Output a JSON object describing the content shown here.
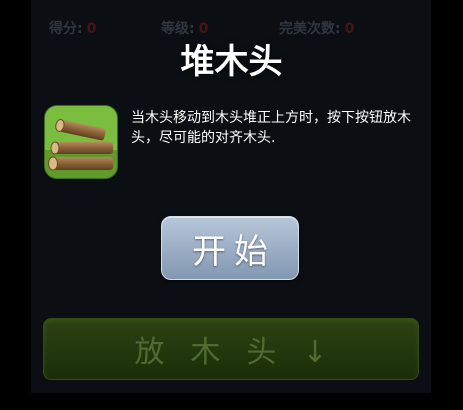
{
  "hud": {
    "score_label": "得分:",
    "score_value": "0",
    "level_label": "等级:",
    "level_value": "0",
    "perfect_label": "完美次数:",
    "perfect_value": "0"
  },
  "overlay": {
    "title": "堆木头",
    "icon": "wood-logs-icon",
    "instructions": "当木头移动到木头堆正上方时，按下按钮放木头，尽可能的对齐木头.",
    "start_label": "开始"
  },
  "controls": {
    "drop_label": "放木头↓"
  },
  "colors": {
    "page_background": "#000000",
    "game_background": "#0b0f14",
    "title_text": "#ffffff",
    "start_button": "#9fb1c8",
    "drop_button": "#2c4313",
    "icon_background": "#7bbd3e"
  }
}
